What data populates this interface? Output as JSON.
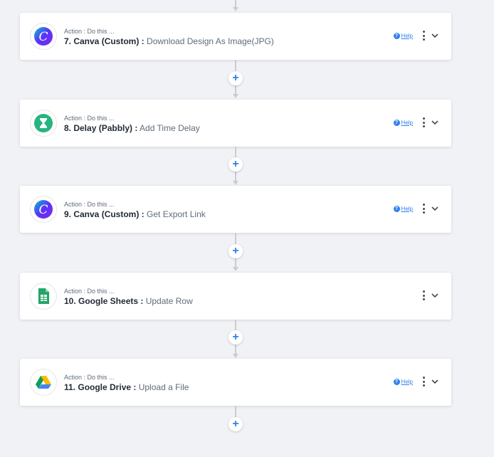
{
  "colors": {
    "background": "#f0f2f5",
    "card": "#ffffff",
    "accent": "#2f80ed",
    "connector": "#c9ccd1"
  },
  "add_step_label": "+",
  "steps": [
    {
      "caption": "Action : Do this ...",
      "title": "7. Canva (Custom) :",
      "description": "Download Design As Image(JPG)",
      "icon": "canva-icon",
      "help_label": "Help",
      "has_help": true
    },
    {
      "caption": "Action : Do this ...",
      "title": "8. Delay (Pabbly) :",
      "description": "Add Time Delay",
      "icon": "hourglass-delay-icon",
      "help_label": "Help",
      "has_help": true
    },
    {
      "caption": "Action : Do this ...",
      "title": "9. Canva (Custom) :",
      "description": "Get Export Link",
      "icon": "canva-icon",
      "help_label": "Help",
      "has_help": true
    },
    {
      "caption": "Action : Do this ...",
      "title": "10. Google Sheets :",
      "description": "Update Row",
      "icon": "google-sheets-icon",
      "help_label": "",
      "has_help": false
    },
    {
      "caption": "Action : Do this ...",
      "title": "11. Google Drive :",
      "description": "Upload a File",
      "icon": "google-drive-icon",
      "help_label": "Help",
      "has_help": true
    }
  ]
}
